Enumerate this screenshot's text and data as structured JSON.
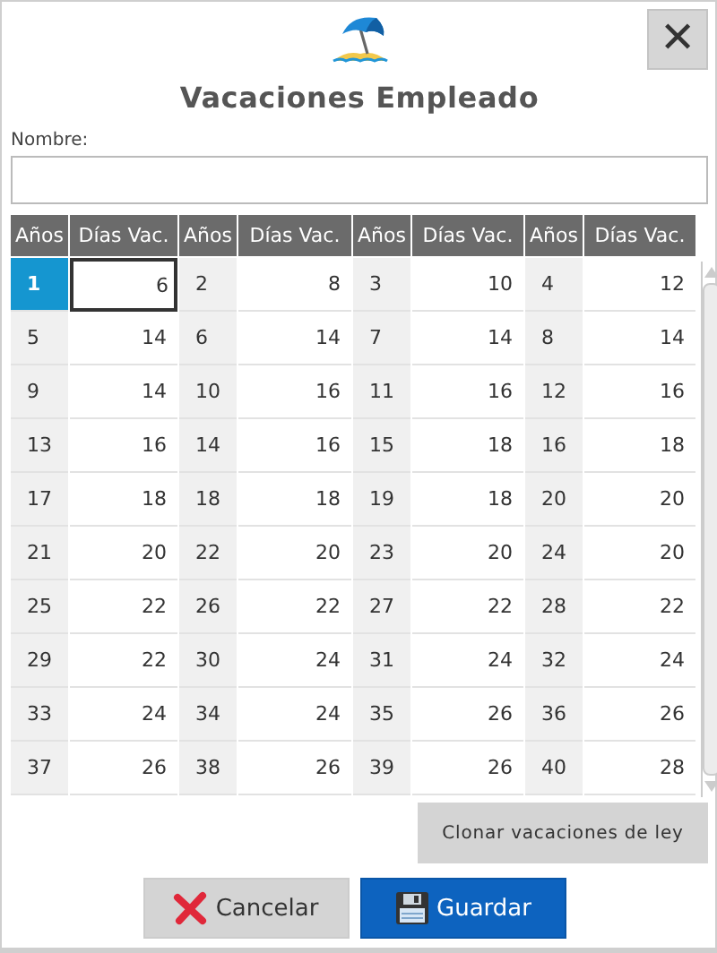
{
  "dialog": {
    "title": "Vacaciones Empleado",
    "close": "✕"
  },
  "name_field": {
    "label": "Nombre:"
  },
  "table": {
    "columns": [
      "Años",
      "Días Vac.",
      "Años",
      "Días Vac.",
      "Años",
      "Días Vac.",
      "Años",
      "Días Vac."
    ],
    "rows": [
      [
        {
          "text": "1",
          "selected": true
        },
        {
          "text": "6",
          "selected": true
        },
        {
          "text": "2",
          "selected": false
        },
        {
          "text": "8",
          "selected": false
        },
        {
          "text": "3",
          "selected": false
        },
        {
          "text": "10",
          "selected": false
        },
        {
          "text": "4",
          "selected": false
        },
        {
          "text": "12",
          "selected": false
        }
      ],
      [
        {
          "text": "5",
          "selected": false
        },
        {
          "text": "14",
          "selected": false
        },
        {
          "text": "6",
          "selected": false
        },
        {
          "text": "14",
          "selected": false
        },
        {
          "text": "7",
          "selected": false
        },
        {
          "text": "14",
          "selected": false
        },
        {
          "text": "8",
          "selected": false
        },
        {
          "text": "14",
          "selected": false
        }
      ],
      [
        {
          "text": "9",
          "selected": false
        },
        {
          "text": "14",
          "selected": false
        },
        {
          "text": "10",
          "selected": false
        },
        {
          "text": "16",
          "selected": false
        },
        {
          "text": "11",
          "selected": false
        },
        {
          "text": "16",
          "selected": false
        },
        {
          "text": "12",
          "selected": false
        },
        {
          "text": "16",
          "selected": false
        }
      ],
      [
        {
          "text": "13",
          "selected": false
        },
        {
          "text": "16",
          "selected": false
        },
        {
          "text": "14",
          "selected": false
        },
        {
          "text": "16",
          "selected": false
        },
        {
          "text": "15",
          "selected": false
        },
        {
          "text": "18",
          "selected": false
        },
        {
          "text": "16",
          "selected": false
        },
        {
          "text": "18",
          "selected": false
        }
      ],
      [
        {
          "text": "17",
          "selected": false
        },
        {
          "text": "18",
          "selected": false
        },
        {
          "text": "18",
          "selected": false
        },
        {
          "text": "18",
          "selected": false
        },
        {
          "text": "19",
          "selected": false
        },
        {
          "text": "18",
          "selected": false
        },
        {
          "text": "20",
          "selected": false
        },
        {
          "text": "20",
          "selected": false
        }
      ],
      [
        {
          "text": "21",
          "selected": false
        },
        {
          "text": "20",
          "selected": false
        },
        {
          "text": "22",
          "selected": false
        },
        {
          "text": "20",
          "selected": false
        },
        {
          "text": "23",
          "selected": false
        },
        {
          "text": "20",
          "selected": false
        },
        {
          "text": "24",
          "selected": false
        },
        {
          "text": "20",
          "selected": false
        }
      ],
      [
        {
          "text": "25",
          "selected": false
        },
        {
          "text": "22",
          "selected": false
        },
        {
          "text": "26",
          "selected": false
        },
        {
          "text": "22",
          "selected": false
        },
        {
          "text": "27",
          "selected": false
        },
        {
          "text": "22",
          "selected": false
        },
        {
          "text": "28",
          "selected": false
        },
        {
          "text": "22",
          "selected": false
        }
      ],
      [
        {
          "text": "29",
          "selected": false
        },
        {
          "text": "22",
          "selected": false
        },
        {
          "text": "30",
          "selected": false
        },
        {
          "text": "24",
          "selected": false
        },
        {
          "text": "31",
          "selected": false
        },
        {
          "text": "24",
          "selected": false
        },
        {
          "text": "32",
          "selected": false
        },
        {
          "text": "24",
          "selected": false
        }
      ],
      [
        {
          "text": "33",
          "selected": false
        },
        {
          "text": "24",
          "selected": false
        },
        {
          "text": "34",
          "selected": false
        },
        {
          "text": "24",
          "selected": false
        },
        {
          "text": "35",
          "selected": false
        },
        {
          "text": "26",
          "selected": false
        },
        {
          "text": "36",
          "selected": false
        },
        {
          "text": "26",
          "selected": false
        }
      ],
      [
        {
          "text": "37",
          "selected": false
        },
        {
          "text": "26",
          "selected": false
        },
        {
          "text": "38",
          "selected": false
        },
        {
          "text": "26",
          "selected": false
        },
        {
          "text": "39",
          "selected": false
        },
        {
          "text": "26",
          "selected": false
        },
        {
          "text": "40",
          "selected": false
        },
        {
          "text": "28",
          "selected": false
        }
      ]
    ]
  },
  "clone_button": "Clonar vacaciones de ley",
  "buttons": [
    {
      "kind": "cancel",
      "label": "Cancelar"
    },
    {
      "kind": "save",
      "label": "Guardar"
    }
  ]
}
